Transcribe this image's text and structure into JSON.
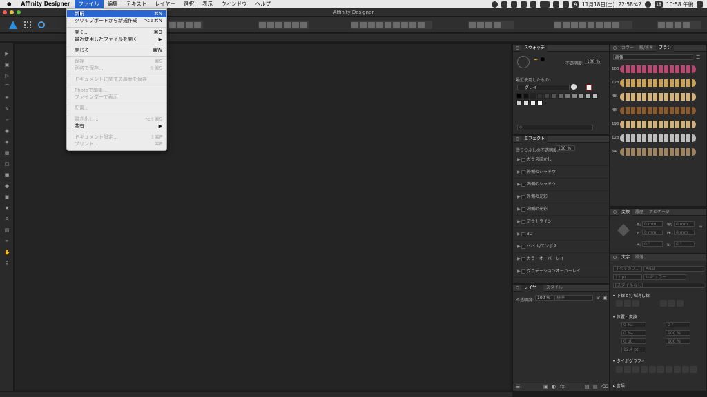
{
  "menubar": {
    "app_name": "Affinity Designer",
    "items": [
      "ファイル",
      "編集",
      "テキスト",
      "レイヤー",
      "選択",
      "表示",
      "ウィンドウ",
      "ヘルプ"
    ],
    "date": "11月18日(土)",
    "time": "22:58:42",
    "clock": "10:58 午後",
    "input_mode": "A",
    "display": "18"
  },
  "window": {
    "title": "Affinity Designer"
  },
  "file_menu": {
    "new": "新規",
    "new_sc": "⌘N",
    "new_clipboard": "クリップボードから新規作成",
    "new_clipboard_sc": "⌥⇧⌘N",
    "open": "開く...",
    "open_sc": "⌘O",
    "open_recent": "最近使用したファイルを開く",
    "close": "閉じる",
    "close_sc": "⌘W",
    "save": "保存",
    "save_sc": "⌘S",
    "save_as": "別名で保存...",
    "save_as_sc": "⇧⌘S",
    "save_history": "ドキュメントに関する履歴を保存",
    "edit_photo": "Photoで編集...",
    "show_finder": "ファインダーで表示",
    "place": "配置...",
    "export": "書き出し...",
    "export_sc": "⌥⇧⌘S",
    "share": "共有",
    "doc_setup": "ドキュメント設定...",
    "doc_setup_sc": "⇧⌘P",
    "print": "プリント...",
    "print_sc": "⌘P"
  },
  "swatches": {
    "tab": "スウォッチ",
    "opacity_label": "不透明度:",
    "opacity_value": "100 %",
    "recent_label": "最近使用したもの:",
    "palette": "グレイ",
    "colors": [
      "#000000",
      "#111111",
      "#222222",
      "#333333",
      "#444444",
      "#555555",
      "#666666",
      "#777777",
      "#888888",
      "#999999",
      "#aaaaaa",
      "#bbbbbb",
      "#cccccc",
      "#dddddd",
      "#eeeeee",
      "#ffffff"
    ]
  },
  "effects": {
    "tab": "エフェクト",
    "fill_opacity_label": "塗りつぶしの不透明度:",
    "fill_opacity_value": "100 %",
    "items": [
      "ガウスぼかし",
      "外側のシャドウ",
      "内側のシャドウ",
      "外側の光彩",
      "内側の光彩",
      "アウトライン",
      "3D",
      "ベベル/エンボス",
      "カラーオーバーレイ",
      "グラデーションオーバーレイ"
    ]
  },
  "layers": {
    "tab": "レイヤー",
    "tab2": "スタイル",
    "opacity_label": "不透明度:",
    "opacity_value": "100 %",
    "blend": "標準"
  },
  "brushes": {
    "tabs": [
      "カラー",
      "線/境界",
      "ブラシ"
    ],
    "category": "画像",
    "sizes": [
      "100",
      "128",
      "48",
      "48",
      "196",
      "128",
      "64"
    ],
    "colors": [
      "#b7486f",
      "#c9a15a",
      "#d2b27a",
      "#8a5a30",
      "#cdb07c",
      "#bbbbbb",
      "#9c8460"
    ]
  },
  "transform": {
    "tabs": [
      "変換",
      "履歴",
      "ナビゲータ"
    ],
    "x_label": "X:",
    "x_value": "0 mm",
    "y_label": "Y:",
    "y_value": "0 mm",
    "w_label": "W:",
    "w_value": "0 mm",
    "h_label": "H:",
    "h_value": "0 mm",
    "r_label": "R:",
    "r_value": "0 °",
    "s_label": "S:",
    "s_value": "0 °"
  },
  "character": {
    "tabs": [
      "文字",
      "段落"
    ],
    "font_collection": "すべてのフ...",
    "font": "Arial",
    "size": "12 pt",
    "weight": "レギュラー",
    "style": "[スタイルなし]",
    "section_decor": "下線と打ち消し線",
    "section_position": "位置と変換",
    "pos_values": [
      "0 ‰",
      "0 ‰",
      "0 pt",
      "12.4 pt"
    ],
    "pos_values2": [
      "0 °",
      "100 %",
      "100 %"
    ],
    "section_typo": "タイポグラフィ",
    "section_lang": "言語"
  }
}
